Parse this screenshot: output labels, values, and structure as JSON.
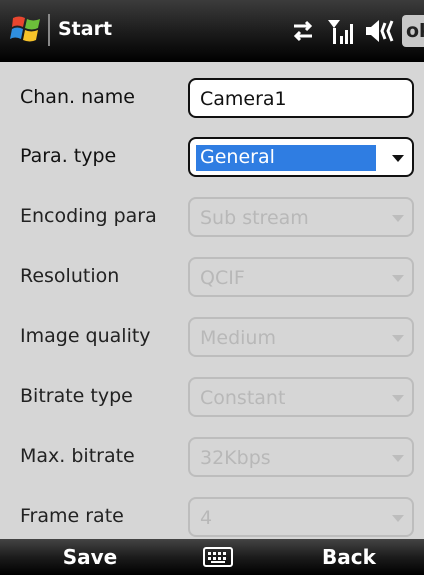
{
  "topbar": {
    "title": "Start",
    "ok_label": "ok"
  },
  "icons": {
    "start": "windows-flag-icon",
    "sync": "sync-arrows-icon",
    "signal": "signal-strength-icon",
    "volume": "speaker-icon",
    "keyboard": "keyboard-icon"
  },
  "form": {
    "channel_name": {
      "label": "Chan. name",
      "value": "Camera1"
    },
    "para_type": {
      "label": "Para. type",
      "value": "General"
    },
    "encoding_para": {
      "label": "Encoding para",
      "value": "Sub stream"
    },
    "resolution": {
      "label": "Resolution",
      "value": "QCIF"
    },
    "image_quality": {
      "label": "Image quality",
      "value": "Medium"
    },
    "bitrate_type": {
      "label": "Bitrate type",
      "value": "Constant"
    },
    "max_bitrate": {
      "label": "Max. bitrate",
      "value": "32Kbps"
    },
    "frame_rate": {
      "label": "Frame rate",
      "value": "4"
    }
  },
  "softkeys": {
    "left": "Save",
    "right": "Back"
  },
  "colors": {
    "selection": "#2f7de2",
    "background": "#d6d6d6",
    "bar": "#1a1a1a"
  }
}
